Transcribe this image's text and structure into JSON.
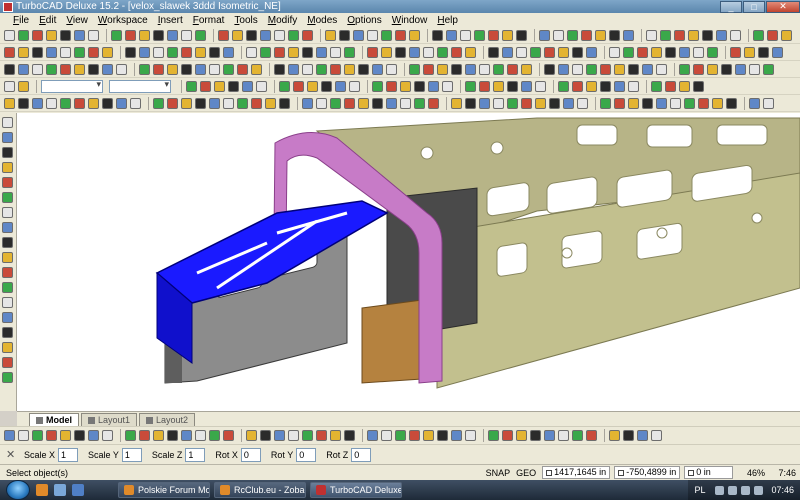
{
  "window": {
    "title": "TurboCAD Deluxe 15.2 - [velox_slawek 3ddd Isometric_NE]",
    "minimize": "_",
    "maximize": "□",
    "close": "✕"
  },
  "menu": [
    "File",
    "Edit",
    "View",
    "Workspace",
    "Insert",
    "Format",
    "Tools",
    "Modify",
    "Modes",
    "Options",
    "Window",
    "Help"
  ],
  "layout_tabs": [
    "Model",
    "Layout1",
    "Layout2"
  ],
  "inspector": {
    "close_glyph": "✕",
    "fields": [
      {
        "label": "Scale X",
        "value": "1"
      },
      {
        "label": "Scale Y",
        "value": "1"
      },
      {
        "label": "Scale Z",
        "value": "1"
      },
      {
        "label": "Rot X",
        "value": "0"
      },
      {
        "label": "Rot Y",
        "value": "0"
      },
      {
        "label": "Rot Z",
        "value": "0"
      }
    ]
  },
  "status": {
    "message": "Select object(s)",
    "snap": "SNAP",
    "geo": "GEO",
    "x": "1417,1645 in",
    "y": "-750,4899 in",
    "z": "0 in",
    "zoom": "46%",
    "time": "7:46"
  },
  "taskbar": {
    "tasks": [
      {
        "label": "Polskie Forum Mod...",
        "color": "#e08a2a"
      },
      {
        "label": "RcClub.eu - Zobacz ...",
        "color": "#e08a2a"
      },
      {
        "label": "TurboCAD Deluxe 1...",
        "color": "#c03030"
      }
    ],
    "language": "PL",
    "clock": "07:46"
  },
  "model_colors": {
    "nose_frame": "#1a1aff",
    "fuselage_panel": "#c2c08e",
    "former": "#c77bc7",
    "lower_box": "#707070"
  }
}
